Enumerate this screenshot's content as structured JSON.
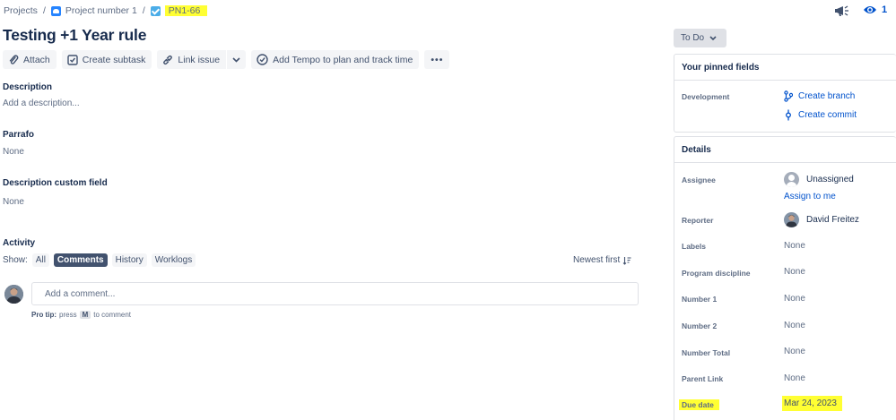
{
  "breadcrumb": {
    "projects": "Projects",
    "project": "Project number 1",
    "issue_key": "PN1-66"
  },
  "watchers": {
    "count": "1"
  },
  "issue": {
    "title": "Testing +1 Year rule"
  },
  "toolbar": {
    "attach": "Attach",
    "create_subtask": "Create subtask",
    "link_issue": "Link issue",
    "tempo": "Add Tempo to plan and track time",
    "more": "•••"
  },
  "fields": {
    "description": {
      "label": "Description",
      "placeholder": "Add a description..."
    },
    "parrafo": {
      "label": "Parrafo",
      "value": "None"
    },
    "description_custom": {
      "label": "Description custom field",
      "value": "None"
    }
  },
  "activity": {
    "heading": "Activity",
    "show_label": "Show:",
    "filters": [
      "All",
      "Comments",
      "History",
      "Worklogs"
    ],
    "active_filter": "Comments",
    "sort": "Newest first",
    "comment_placeholder": "Add a comment...",
    "protip_label": "Pro tip:",
    "protip_press": "press",
    "protip_key": "M",
    "protip_suffix": "to comment"
  },
  "status": {
    "label": "To Do"
  },
  "pinned": {
    "heading": "Your pinned fields",
    "development_label": "Development",
    "create_branch": "Create branch",
    "create_commit": "Create commit"
  },
  "details": {
    "heading": "Details",
    "assignee_label": "Assignee",
    "assignee_value": "Unassigned",
    "assign_to_me": "Assign to me",
    "reporter_label": "Reporter",
    "reporter_value": "David Freitez",
    "rows": [
      {
        "label": "Labels",
        "value": "None"
      },
      {
        "label": "Program discipline",
        "value": "None"
      },
      {
        "label": "Number 1",
        "value": "None"
      },
      {
        "label": "Number 2",
        "value": "None"
      },
      {
        "label": "Number Total",
        "value": "None"
      },
      {
        "label": "Parent Link",
        "value": "None"
      }
    ],
    "due_label": "Due date",
    "due_value": "Mar 24, 2023"
  },
  "colors": {
    "accent": "#0052cc",
    "highlight": "#ffff33",
    "chip_active": "#42526e"
  },
  "icons": [
    "project-icon",
    "task-icon",
    "megaphone-icon",
    "eye-icon",
    "paperclip-icon",
    "subtask-icon",
    "link-icon",
    "chevron-down-icon",
    "tempo-check-icon",
    "more-icon",
    "sort-icon",
    "branch-icon",
    "commit-icon"
  ]
}
